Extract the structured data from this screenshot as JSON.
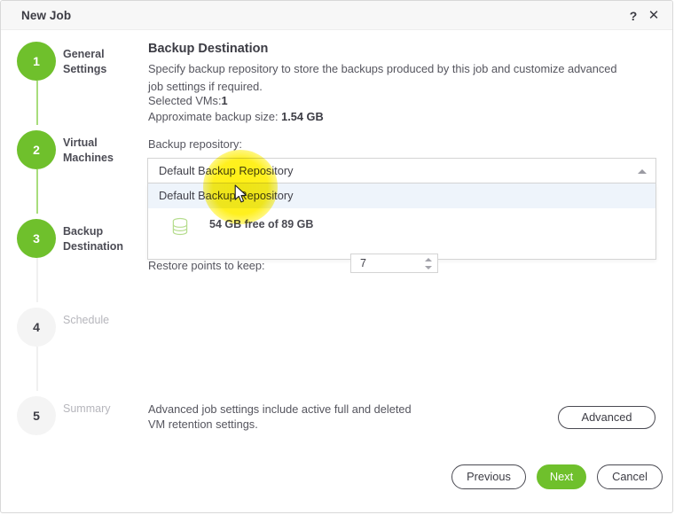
{
  "window": {
    "title": "New Job",
    "help_icon": "question-mark-icon",
    "close_icon": "close-icon"
  },
  "stepper": {
    "steps": [
      {
        "number": "1",
        "label": "General Settings",
        "state": "active"
      },
      {
        "number": "2",
        "label": "Virtual Machines",
        "state": "active"
      },
      {
        "number": "3",
        "label": "Backup Destination",
        "state": "active"
      },
      {
        "number": "4",
        "label": "Schedule",
        "state": "inactive"
      },
      {
        "number": "5",
        "label": "Summary",
        "state": "inactive"
      }
    ]
  },
  "main": {
    "title": "Backup Destination",
    "description": "Specify backup repository to store the backups produced by this job and customize advanced job settings if required.",
    "selected_vms_label": "Selected VMs:",
    "selected_vms_value": "1",
    "approx_size_label": "Approximate backup size: ",
    "approx_size_value": "1.54 GB",
    "repository_label": "Backup repository:",
    "repository": {
      "selected": "Default Backup Repository",
      "expanded": true,
      "caret_icon": "chevron-up-icon",
      "options": [
        {
          "label": "Default Backup Repository",
          "highlighted": true
        }
      ],
      "capacity_icon": "database-cylinder-icon",
      "capacity_text": "54 GB free of 89 GB"
    },
    "restore_points_label": "Restore points to keep:",
    "restore_points_value": "7",
    "restore_points_spinner_icon": "spinner-up-down-icon"
  },
  "footer": {
    "note": "Advanced job settings include active full and deleted VM retention settings.",
    "advanced_label": "Advanced",
    "previous_label": "Previous",
    "next_label": "Next",
    "cancel_label": "Cancel"
  },
  "colors": {
    "accent_green": "#6fc02c",
    "connector_green": "#a8dd7c",
    "highlight_blue": "#eef4fb",
    "cursor_halo_yellow": "#ffee00",
    "title_bar": "#f7f7f7",
    "border": "#d4d4d4"
  }
}
